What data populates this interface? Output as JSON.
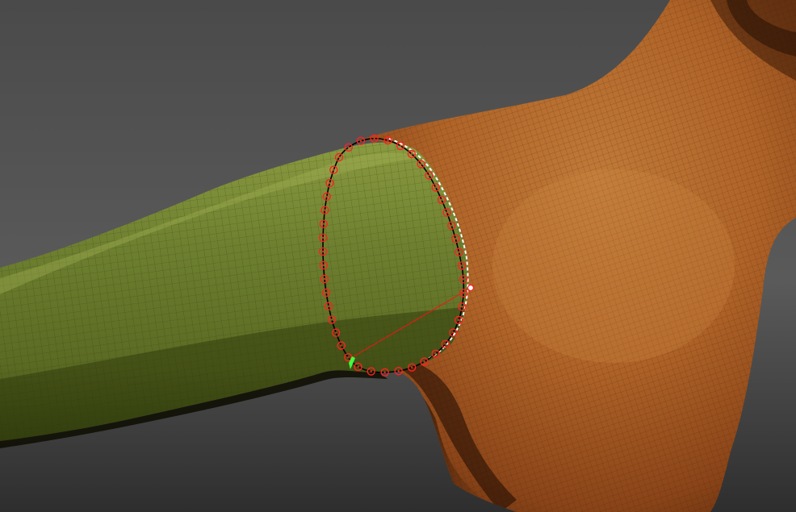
{
  "viewport": {
    "background_top": "#505050",
    "background_bottom": "#2c2c2c",
    "shading": "clay-wireframe"
  },
  "mesh": {
    "arm_color": "#6a7a2e",
    "arm_shadow_color": "#3e4a16",
    "body_color": "#b4682a",
    "body_shadow_color": "#6a3210",
    "wire_color": "#2a1a08"
  },
  "selection_loop": {
    "tool": "edge-loop-selection",
    "vertex_marker_color": "#ff2020",
    "loop_line_color": "#000000",
    "highlight_dash_color": "#ffffff",
    "guide_line_color": "#ff1010",
    "pivot_color": "#40ff40"
  }
}
